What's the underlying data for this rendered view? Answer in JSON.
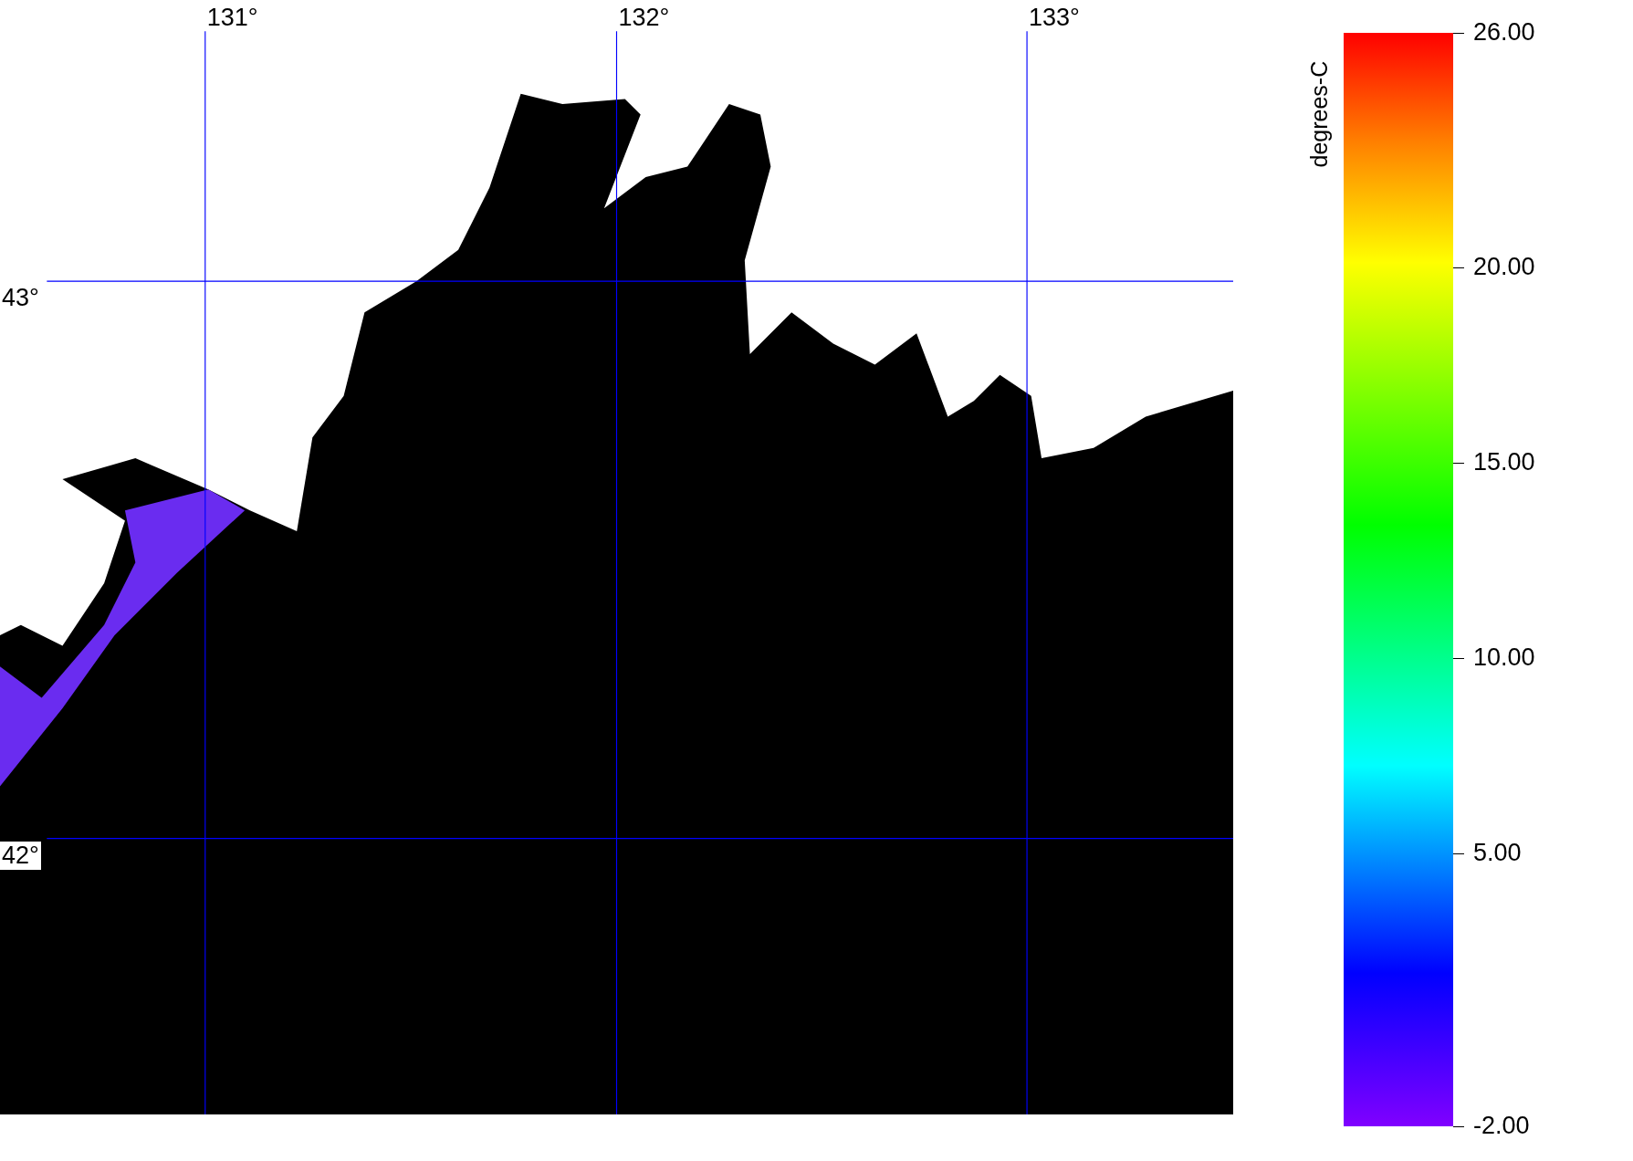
{
  "map": {
    "longitude_labels": [
      "131°",
      "132°",
      "133°"
    ],
    "latitude_labels": [
      "43°",
      "42°"
    ]
  },
  "colorbar": {
    "units": "degrees-C",
    "tick_labels": [
      "26.00",
      "20.00",
      "15.00",
      "10.00",
      "5.00",
      "-2.00"
    ]
  }
}
